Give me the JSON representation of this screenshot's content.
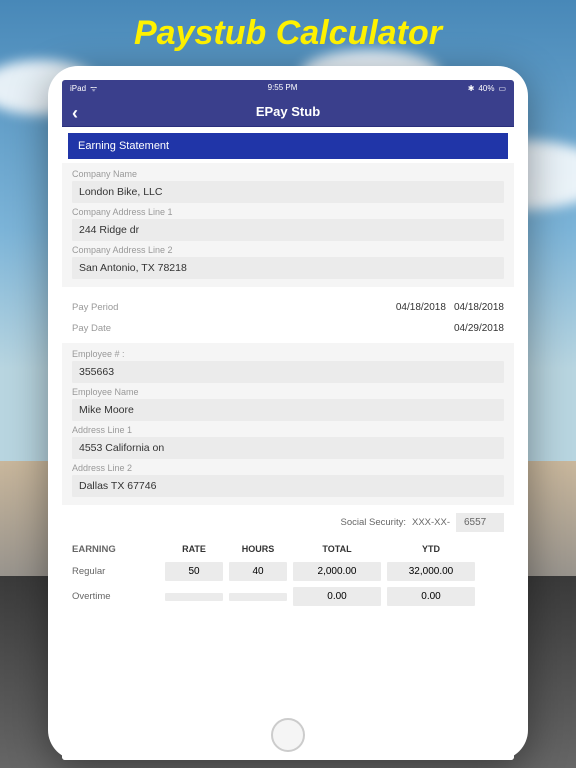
{
  "page_title": "Paystub Calculator",
  "status": {
    "device": "iPad",
    "wifi": "᯼",
    "time": "9:55 PM",
    "bt": "⚫",
    "battery_pct": "40%",
    "battery": "▭"
  },
  "nav": {
    "back": "‹",
    "title": "EPay Stub"
  },
  "section_header": "Earning Statement",
  "company": {
    "name_label": "Company Name",
    "name": "London Bike, LLC",
    "addr1_label": "Company Address Line 1",
    "addr1": "244 Ridge dr",
    "addr2_label": "Company Address Line 2",
    "addr2": "San Antonio, TX 78218"
  },
  "pay": {
    "period_label": "Pay Period",
    "period_from": "04/18/2018",
    "period_to": "04/18/2018",
    "date_label": "Pay Date",
    "date": "04/29/2018"
  },
  "employee": {
    "num_label": "Employee # :",
    "num": "355663",
    "name_label": "Employee Name",
    "name": "Mike Moore",
    "addr1_label": "Address Line 1",
    "addr1": "4553 California on",
    "addr2_label": "Address Line 2",
    "addr2": "Dallas TX 67746"
  },
  "ss": {
    "label": "Social Security:",
    "mask": "XXX-XX-",
    "last4": "6557"
  },
  "earn": {
    "headers": {
      "c1": "EARNING",
      "c2": "RATE",
      "c3": "HOURS",
      "c4": "TOTAL",
      "c5": "YTD"
    },
    "rows": [
      {
        "name": "Regular",
        "rate": "50",
        "hours": "40",
        "total": "2,000.00",
        "ytd": "32,000.00"
      },
      {
        "name": "Overtime",
        "rate": "",
        "hours": "",
        "total": "0.00",
        "ytd": "0.00"
      }
    ]
  }
}
